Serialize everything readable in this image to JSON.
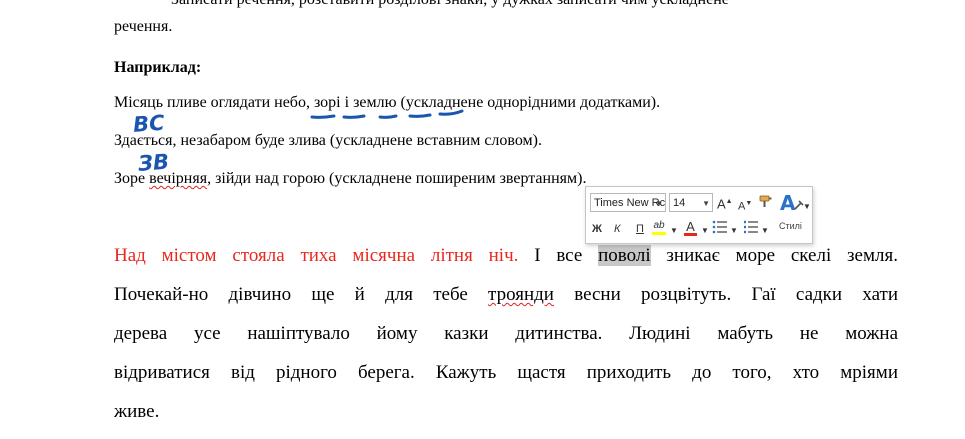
{
  "document": {
    "top_clipped": "Записати речення, розставити розділові знаки, у дужках записати чим ускладнене",
    "top_line2": "речення.",
    "example_heading": "Наприклад:",
    "ex1_a": "Місяць пливе оглядати ",
    "ex1_b": "небо, зорі і землю",
    "ex1_c": "  (ускладнене однорідними додатками).",
    "ex2": "Здається, незабаром буде злива  (ускладнене вставним словом).",
    "ex3_a": "Зоре ",
    "ex3_b": "вечірняя",
    "ex3_c": ", зійди над горою (ускладнене поширеним звертанням).",
    "para1_red": "Над містом стояла тиха місячна літня ніч.",
    "para1_b": " І все ",
    "para1_sel": "поволі",
    "para1_c": " зникає море скелі земля.",
    "para2_a": "Почекай-но дівчино ще й для тебе ",
    "para2_b": "троянди",
    "para2_c": " весни розцвітуть. Гаї садки хати",
    "para3": "дерева усе нашіптувало йому казки дитинства. Людині мабуть не можна",
    "para4": "відриватися від рідного берега. Кажуть щастя приходить до того, хто мріями",
    "para5": "живе."
  },
  "annotations": {
    "handwritten_1": "ВС",
    "handwritten_2": "ЗВ",
    "ink_color": "#1a56b0"
  },
  "mini_toolbar": {
    "font_name": "Times New Rc",
    "font_size": "14",
    "grow_font": "A",
    "shrink_font": "A",
    "bold": "Ж",
    "italic": "К",
    "underline": "П",
    "highlight": "ab",
    "font_color": "A",
    "styles_label": "Стилі",
    "highlight_color": "#ffff00",
    "font_color_value": "#e8281e"
  }
}
